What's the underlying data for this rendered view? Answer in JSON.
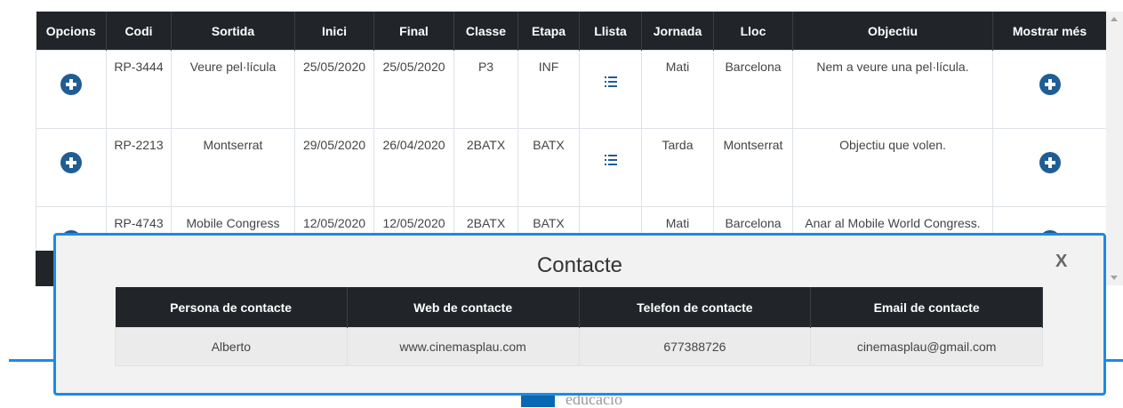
{
  "main_table": {
    "headers": [
      "Opcions",
      "Codi",
      "Sortida",
      "Inici",
      "Final",
      "Classe",
      "Etapa",
      "Llista",
      "Jornada",
      "Lloc",
      "Objectiu",
      "Mostrar més"
    ],
    "rows": [
      {
        "codi": "RP-3444",
        "sortida": "Veure pel·lícula",
        "inici": "25/05/2020",
        "final": "25/05/2020",
        "classe": "P3",
        "etapa": "INF",
        "jornada": "Mati",
        "lloc": "Barcelona",
        "objectiu": "Nem a veure una pel·lícula."
      },
      {
        "codi": "RP-2213",
        "sortida": "Montserrat",
        "inici": "29/05/2020",
        "final": "26/04/2020",
        "classe": "2BATX",
        "etapa": "BATX",
        "jornada": "Tarda",
        "lloc": "Montserrat",
        "objectiu": "Objectiu que volen."
      },
      {
        "codi": "RP-4743",
        "sortida": "Mobile Congress",
        "inici": "12/05/2020",
        "final": "12/05/2020",
        "classe": "2BATX",
        "etapa": "BATX",
        "jornada": "Mati",
        "lloc": "Barcelona",
        "objectiu": "Anar al Mobile World Congress."
      }
    ]
  },
  "modal": {
    "title": "Contacte",
    "close_label": "X",
    "headers": [
      "Persona de contacte",
      "Web de contacte",
      "Telefon de contacte",
      "Email de contacte"
    ],
    "row": {
      "persona": "Alberto",
      "web": "www.cinemasplau.com",
      "telefon": "677388726",
      "email": "cinemasplau@gmail.com"
    }
  },
  "footer": {
    "text": "educació"
  },
  "icons": {
    "options": "plus-circle-icon",
    "list": "list-icon",
    "more": "plus-circle-icon"
  },
  "colors": {
    "accent": "#1c8ae6",
    "header_bg": "#212529",
    "icon": "#1f5d94"
  }
}
